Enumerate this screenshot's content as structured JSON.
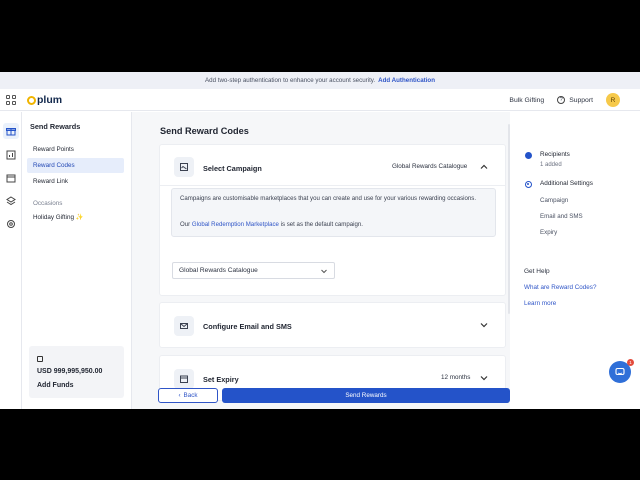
{
  "banner": {
    "text": "Add two-step authentication to enhance your account security.",
    "link": "Add Authentication"
  },
  "header": {
    "brand": "plum",
    "bulk_gifting": "Bulk Gifting",
    "support": "Support",
    "avatar_initial": "R"
  },
  "rail": {
    "icons": [
      "gift-icon",
      "chart-icon",
      "calendar-icon",
      "layers-icon",
      "settings-icon"
    ]
  },
  "sidebar": {
    "title": "Send Rewards",
    "items": [
      {
        "label": "Reward Points"
      },
      {
        "label": "Reward Codes"
      },
      {
        "label": "Reward Link"
      }
    ],
    "occasions_label": "Occasions",
    "occasion_item": "Holiday Gifting",
    "occasion_emoji": "✨",
    "balance": "USD 999,995,950.00",
    "add_funds": "Add Funds"
  },
  "main": {
    "title": "Send Reward Codes",
    "campaign": {
      "title": "Select Campaign",
      "value": "Global Rewards Catalogue",
      "info_line1": "Campaigns are customisable marketplaces that you can create and use for your various rewarding occasions.",
      "info_prefix": "Our",
      "info_link": "Global Redemption Marketplace",
      "info_suffix": "is set as the default campaign.",
      "select_value": "Global Rewards Catalogue"
    },
    "email": {
      "title": "Configure Email and SMS"
    },
    "expiry": {
      "title": "Set Expiry",
      "value": "12 months"
    },
    "back": "Back",
    "send": "Send Rewards"
  },
  "steps": {
    "recipients": "Recipients",
    "recipients_sub": "1 added",
    "additional": "Additional Settings",
    "substeps": [
      "Campaign",
      "Email and SMS",
      "Expiry"
    ],
    "help_title": "Get Help",
    "help_link1": "What are Reward Codes?",
    "help_link2": "Learn more"
  },
  "chat": {
    "badge": "1"
  },
  "colors": {
    "primary": "#2453c9",
    "link": "#2f55c7",
    "logo_ring": "#f0b400",
    "avatar": "#f6c94a"
  }
}
